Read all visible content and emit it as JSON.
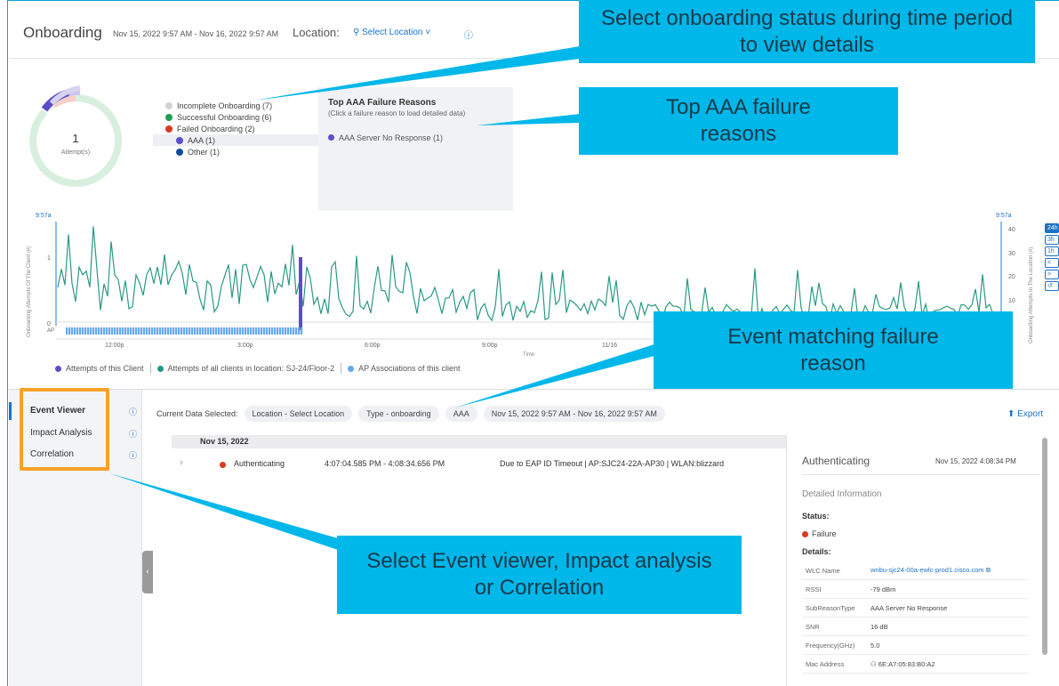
{
  "header": {
    "title": "Onboarding",
    "date_range": "Nov 15, 2022 9:57 AM - Nov 16, 2022 9:57 AM",
    "location_label": "Location:",
    "location_select": "Select Location",
    "chevron": "˅",
    "info_glyph": "ⓘ",
    "pin_glyph": "⚲"
  },
  "donut": {
    "value": "1",
    "label": "Attempt(s)"
  },
  "legend": {
    "items": [
      {
        "label": "Incomplete Onboarding (7)",
        "color": "#d3d3d3"
      },
      {
        "label": "Successful Onboarding (6)",
        "color": "#1f9d55"
      },
      {
        "label": "Failed Onboarding (2)",
        "color": "#d93a1e"
      },
      {
        "label": "AAA (1)",
        "color": "#5a4fc8"
      },
      {
        "label": "Other (1)",
        "color": "#0e4d9a"
      }
    ]
  },
  "aaa_panel": {
    "title": "Top AAA Failure Reasons",
    "subtitle": "(Click a failure reason to load detailed data)",
    "item": "AAA Server No Response (1)",
    "item_color": "#5a4fc8"
  },
  "timeline": {
    "left_time": "9:57a",
    "right_time": "9:57a",
    "left_axis_label": "Onboarding Attempts Of The Client (#)",
    "right_axis_label": "Onboarding Attempts In The Location (#)",
    "left_ticks": [
      "1",
      "0"
    ],
    "right_ticks": [
      "40",
      "30",
      "20",
      "10"
    ],
    "ap_label": "AP",
    "x_ticks": [
      "12:00p",
      "3:00p",
      "6:00p",
      "9:00p",
      "11/16"
    ],
    "x_title": "Time",
    "series_color": "#2a9985",
    "client_color": "#5a4fc8",
    "ap_color": "#64a8ee"
  },
  "chart_legend": [
    {
      "label": "Attempts of this Client",
      "color": "#5a4fc8"
    },
    {
      "label": "Attempts of all clients in location: SJ-24/Floor-2",
      "color": "#1f9987"
    },
    {
      "label": "AP Associations of this client",
      "color": "#64a8ee"
    }
  ],
  "range_buttons": [
    "24h",
    "3h",
    "1h",
    "<",
    ">",
    "↺"
  ],
  "nav": {
    "items": [
      "Event Viewer",
      "Impact Analysis",
      "Correlation"
    ],
    "info_glyph": "ⓘ",
    "handle_glyph": "‹"
  },
  "filters": {
    "label": "Current Data Selected:",
    "chips": [
      "Location - Select Location",
      "Type - onboarding",
      "AAA",
      "Nov 15, 2022 9:57 AM - Nov 16, 2022 9:57 AM"
    ],
    "export": "Export",
    "export_glyph": "⬆"
  },
  "events": {
    "date": "Nov 15, 2022",
    "rows": [
      {
        "expander": "›",
        "name": "Authenticating",
        "time": "4:07:04.585 PM - 4:08:34.656 PM",
        "detail": "Due to EAP ID Timeout | AP:SJC24-22A-AP30 | WLAN:blizzard",
        "status_color": "#d93a1e"
      }
    ]
  },
  "detail_panel": {
    "title": "Authenticating",
    "time": "Nov 15, 2022 4:08:34 PM",
    "section": "Detailed Information",
    "status_label": "Status:",
    "status": "Failure",
    "details_label": "Details:",
    "rows": [
      {
        "key": "WLC Name",
        "value": "wnbu-sjc24-00a-ewlc-prod1.cisco.com ⧉",
        "link": true
      },
      {
        "key": "RSSI",
        "value": "-79 dBm",
        "link": false
      },
      {
        "key": "SubReasonType",
        "value": "AAA Server No Response",
        "link": false
      },
      {
        "key": "SNR",
        "value": "16 dB",
        "link": false
      },
      {
        "key": "Frequency(GHz)",
        "value": "5.0",
        "link": false
      },
      {
        "key": "Mac Address",
        "value": "⚇ 6E:A7:05:83:B0:A2",
        "link": false
      }
    ]
  },
  "callouts": {
    "status": "Select onboarding status during time period to view details",
    "aaa": "Top AAA failure reasons",
    "event": "Event matching failure reason",
    "nav": "Select Event viewer, Impact analysis or Correlation"
  }
}
